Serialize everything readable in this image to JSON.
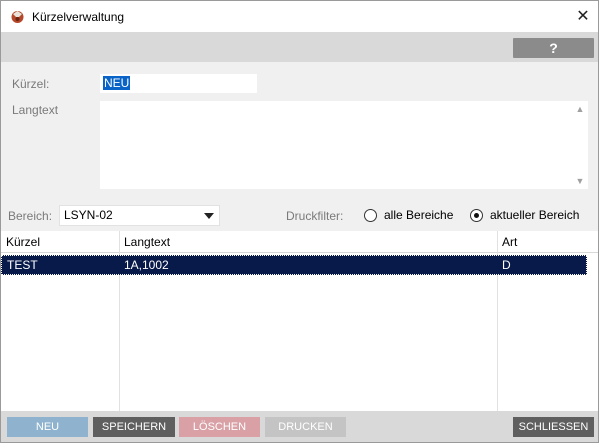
{
  "window": {
    "title": "Kürzelverwaltung"
  },
  "toolbar": {
    "help_label": "?"
  },
  "form": {
    "kuerzel_label": "Kürzel:",
    "kuerzel_value": "NEU",
    "langtext_label": "Langtext",
    "langtext_value": ""
  },
  "filter": {
    "bereich_label": "Bereich:",
    "bereich_value": "LSYN-02",
    "druckfilter_label": "Druckfilter:",
    "option_all": "alle Bereiche",
    "option_current": "aktueller Bereich",
    "selected": "aktueller Bereich"
  },
  "table": {
    "columns": [
      "Kürzel",
      "Langtext",
      "Art"
    ],
    "rows": [
      {
        "kuerzel": "TEST",
        "langtext": "1A,1002",
        "art": "D",
        "selected": true
      }
    ]
  },
  "buttons": {
    "neu": "NEU",
    "speichern": "SPEICHERN",
    "loeschen": "LÖSCHEN",
    "drucken": "DRUCKEN",
    "schliessen": "SCHLIESSEN"
  },
  "colors": {
    "neu_button": "#8fb3ce",
    "dark_button": "#5f5f5f",
    "loeschen_button": "#d9a0a6",
    "drucken_button": "#c4c4c4",
    "selected_row": "#071a4a",
    "selection_highlight": "#0a64c8"
  }
}
